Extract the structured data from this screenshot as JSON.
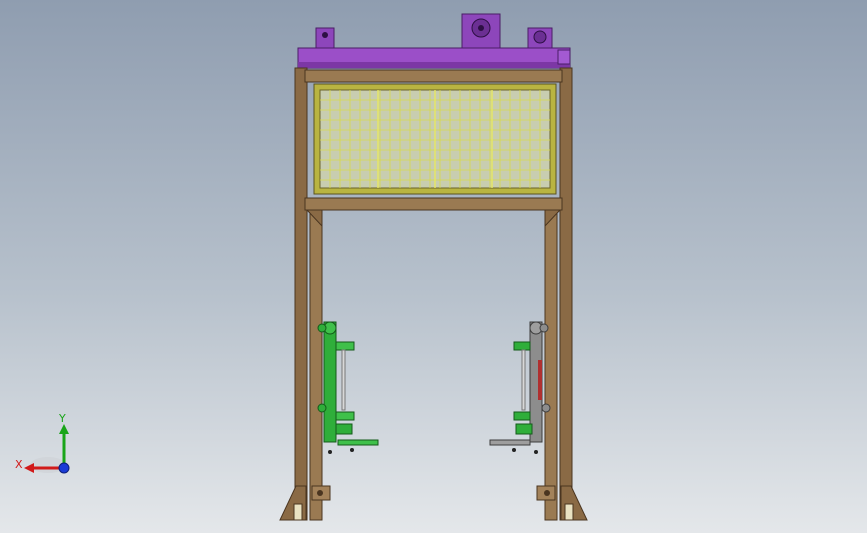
{
  "viewport": {
    "background_top": "#8f9db0",
    "background_bottom": "#e4e7ea"
  },
  "model": {
    "frame_color": "#8a6a45",
    "top_plate_color": "#9b4fc8",
    "mesh_panel_color": "#d9d94a",
    "left_gripper_color": "#2fae3a",
    "right_gripper_color": "#8d8d8d"
  },
  "triad": {
    "x_label": "X",
    "y_label": "Y",
    "x_color": "#d11a1a",
    "y_color": "#19a519",
    "z_color": "#1a3bd6"
  }
}
